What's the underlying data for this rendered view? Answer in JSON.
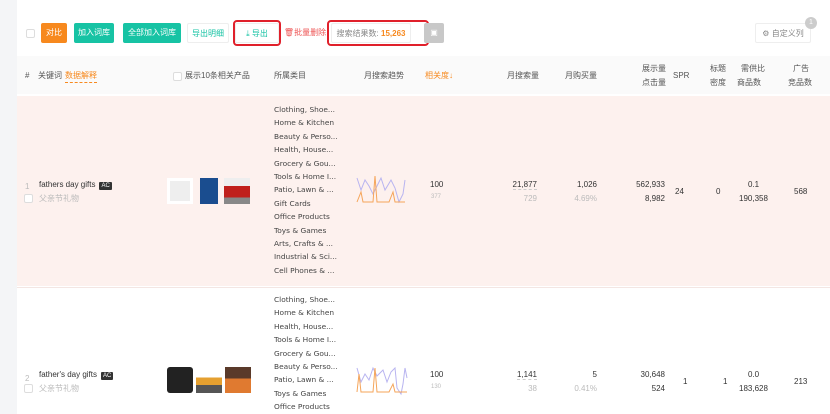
{
  "toolbar": {
    "compare": "对比",
    "add_to_lib": "加入词库",
    "add_all": "全部加入词库",
    "export_detail": "导出明细",
    "export": "导出",
    "batch_delete": "批量删除",
    "result_label": "搜索结果数:",
    "result_count": "15,263",
    "custom_columns": "自定义列",
    "badge": "1"
  },
  "colors": {
    "orange": "#f7891e",
    "teal": "#17c3a4",
    "red": "#e0202b",
    "row_highlight": "#fdf1ee"
  },
  "header": {
    "index": "#",
    "keyword": "关键词",
    "data_explain": "数据解释",
    "show_products": "展示10条相关产品",
    "category": "所属类目",
    "trend": "月搜索趋势",
    "relevance": "相关度↓",
    "monthly_search": "月搜索量",
    "monthly_purchase": "月购买量",
    "impressions": "展示量",
    "clicks": "点击量",
    "spr": "SPR",
    "title_1": "标题",
    "title_2": "密度",
    "supply_1": "需供比",
    "supply_2": "商品数",
    "ads_1": "广告",
    "ads_2": "竞品数"
  },
  "rows": [
    {
      "index": "1",
      "keyword": "fathers day gifts",
      "tag": "AC",
      "translation": "父亲节礼物",
      "categories": [
        "Clothing, Shoe...",
        "Home & Kitchen",
        "Beauty & Perso...",
        "Health, House...",
        "Grocery & Gou...",
        "Tools & Home I...",
        "Patio, Lawn & ...",
        "Gift Cards",
        "Office Products",
        "Toys & Games",
        "Arts, Crafts & ...",
        "Industrial & Sci...",
        "Cell Phones & ..."
      ],
      "relevance": "100",
      "relevance_sub": "377",
      "search": "21,877",
      "search_sub": "729",
      "purchase": "1,026",
      "purchase_rate": "4.69%",
      "impressions": "562,933",
      "clicks": "8,982",
      "spr": "24",
      "title_density": "0",
      "supply_ratio": "0.1",
      "product_count": "190,358",
      "ads": "568"
    },
    {
      "index": "2",
      "keyword": "father's day gifts",
      "tag": "AC",
      "translation": "父亲节礼物",
      "categories": [
        "Clothing, Shoe...",
        "Home & Kitchen",
        "Health, House...",
        "Tools & Home I...",
        "Grocery & Gou...",
        "Beauty & Perso...",
        "Patio, Lawn & ...",
        "Toys & Games",
        "Office Products"
      ],
      "relevance": "100",
      "relevance_sub": "130",
      "search": "1,141",
      "search_sub": "38",
      "purchase": "5",
      "purchase_rate": "0.41%",
      "impressions": "30,648",
      "clicks": "524",
      "spr": "1",
      "title_density": "1",
      "supply_ratio": "0.0",
      "product_count": "183,628",
      "ads": "213"
    }
  ]
}
